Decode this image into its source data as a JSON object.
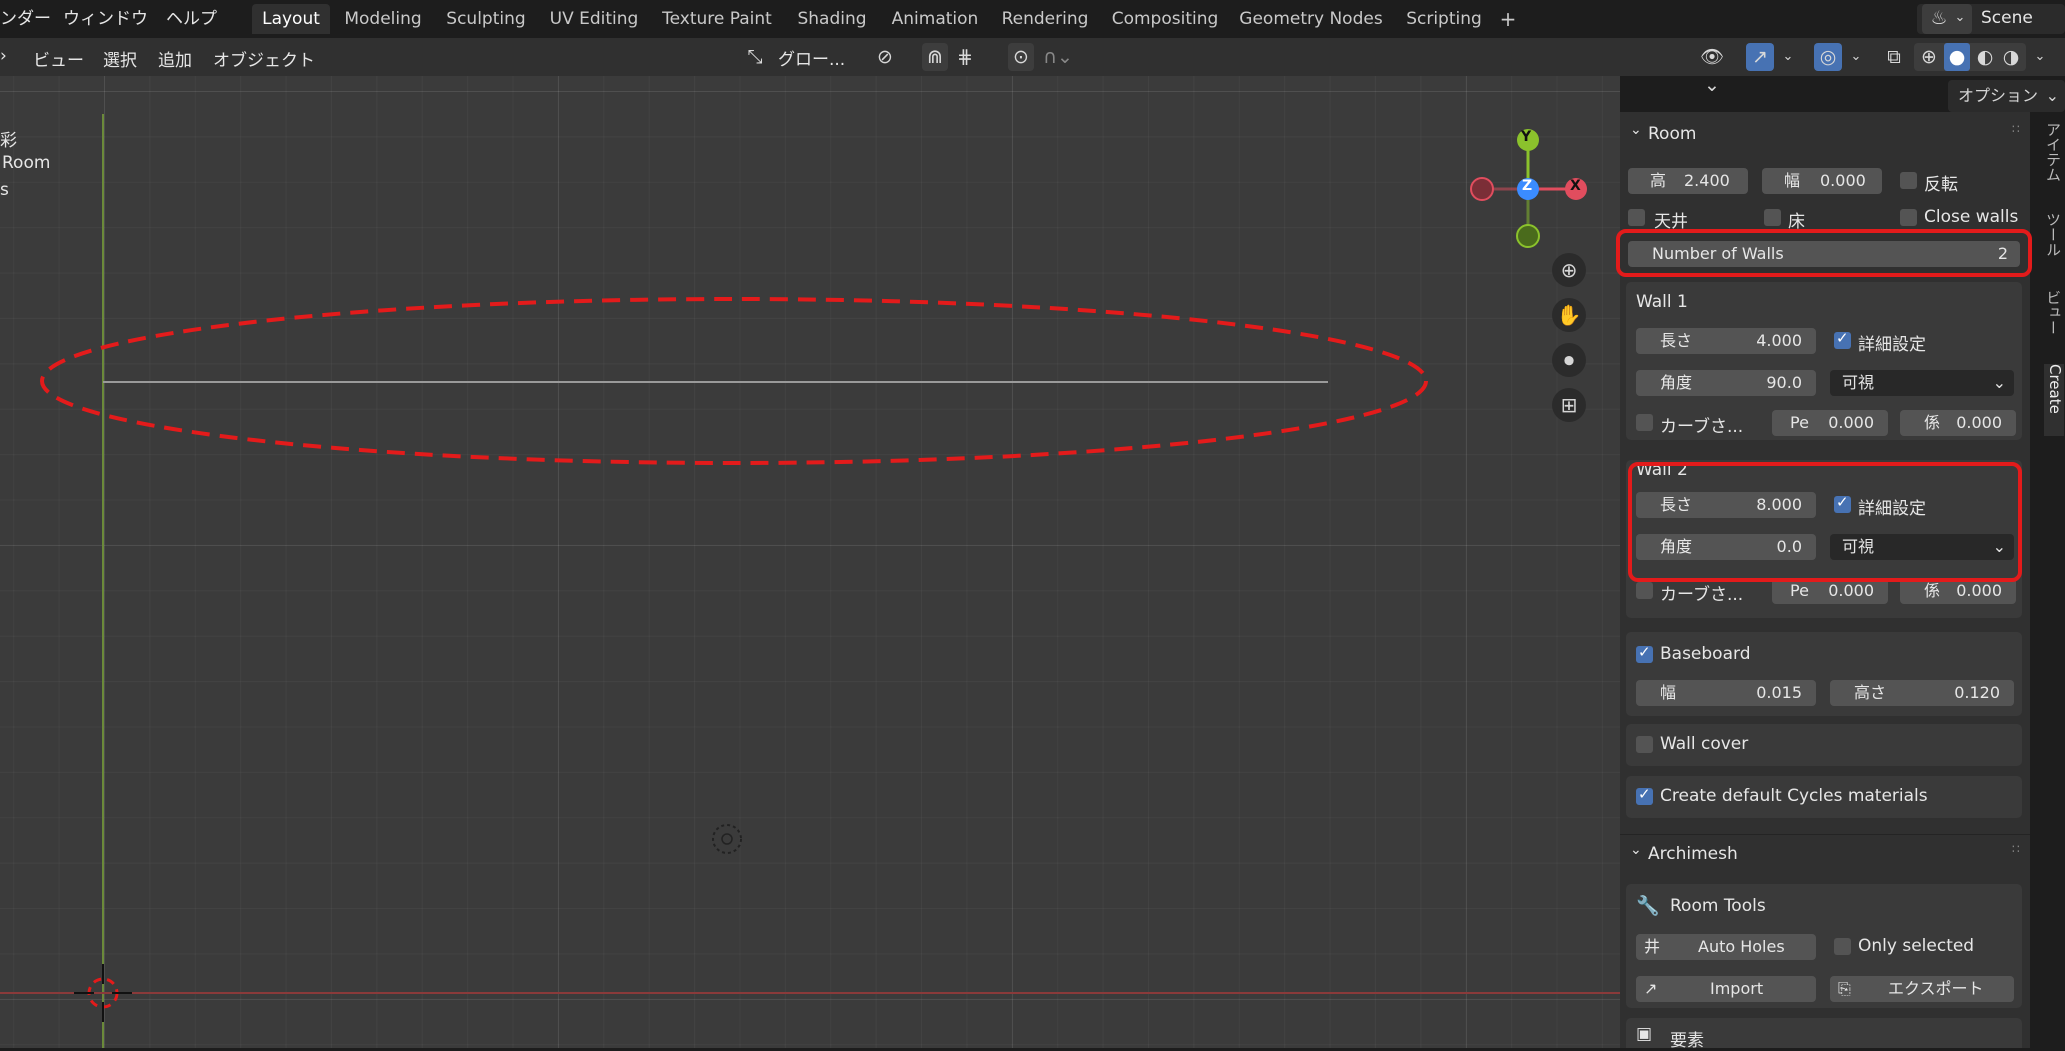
{
  "menus": [
    "ンダー",
    "ウィンドウ",
    "ヘルプ"
  ],
  "workspace_tabs": [
    "Layout",
    "Modeling",
    "Sculpting",
    "UV Editing",
    "Texture Paint",
    "Shading",
    "Animation",
    "Rendering",
    "Compositing",
    "Geometry Nodes",
    "Scripting"
  ],
  "add_tab": "+",
  "scene": "Scene",
  "header": {
    "menus": [
      "ビュー",
      "選択",
      "追加",
      "オブジェクト"
    ],
    "transform_orientation": "グロー...",
    "options_label": "オプション"
  },
  "overlay_text": {
    "line1": "彩",
    "line2": "Room",
    "line3": "s"
  },
  "gizmo": {
    "y": "Y",
    "z": "Z",
    "x": "X"
  },
  "room_panel": {
    "title": "Room",
    "height_label": "高",
    "height_value": "2.400",
    "width_label": "幅",
    "width_value": "0.000",
    "invert_label": "反転",
    "ceiling_label": "天井",
    "floor_label": "床",
    "close_walls_label": "Close walls",
    "walls_label": "Number of Walls",
    "walls_value": "2",
    "wall1": {
      "title": "Wall 1",
      "length_label": "長さ",
      "length_value": "4.000",
      "advanced_label": "詳細設定",
      "angle_label": "角度",
      "angle_value": "90.0",
      "visibility": "可視",
      "curve_label": "カーブさ...",
      "pe_label": "Pe",
      "pe_value": "0.000",
      "coef_label": "係",
      "coef_value": "0.000"
    },
    "wall2": {
      "title": "Wall 2",
      "length_label": "長さ",
      "length_value": "8.000",
      "advanced_label": "詳細設定",
      "angle_label": "角度",
      "angle_value": "0.0",
      "visibility": "可視",
      "curve_label": "カーブさ...",
      "pe_label": "Pe",
      "pe_value": "0.000",
      "coef_label": "係",
      "coef_value": "0.000"
    },
    "baseboard_label": "Baseboard",
    "bb_width_label": "幅",
    "bb_width_value": "0.015",
    "bb_height_label": "高さ",
    "bb_height_value": "0.120",
    "wall_cover_label": "Wall cover",
    "cycles_label": "Create default Cycles materials"
  },
  "archimesh_panel": {
    "title": "Archimesh",
    "room_tools": "Room Tools",
    "auto_holes": "Auto Holes",
    "only_selected": "Only selected",
    "import": "Import",
    "export": "エクスポート",
    "elements": "要素"
  },
  "side_tabs": [
    "アイテム",
    "ツール",
    "ビュー",
    "Create"
  ],
  "colors": {
    "accent": "#4772b3",
    "highlight": "#e31b1b",
    "x_axis": "#e14d5e",
    "y_axis": "#8bc22c",
    "z_axis": "#3b8cff"
  }
}
